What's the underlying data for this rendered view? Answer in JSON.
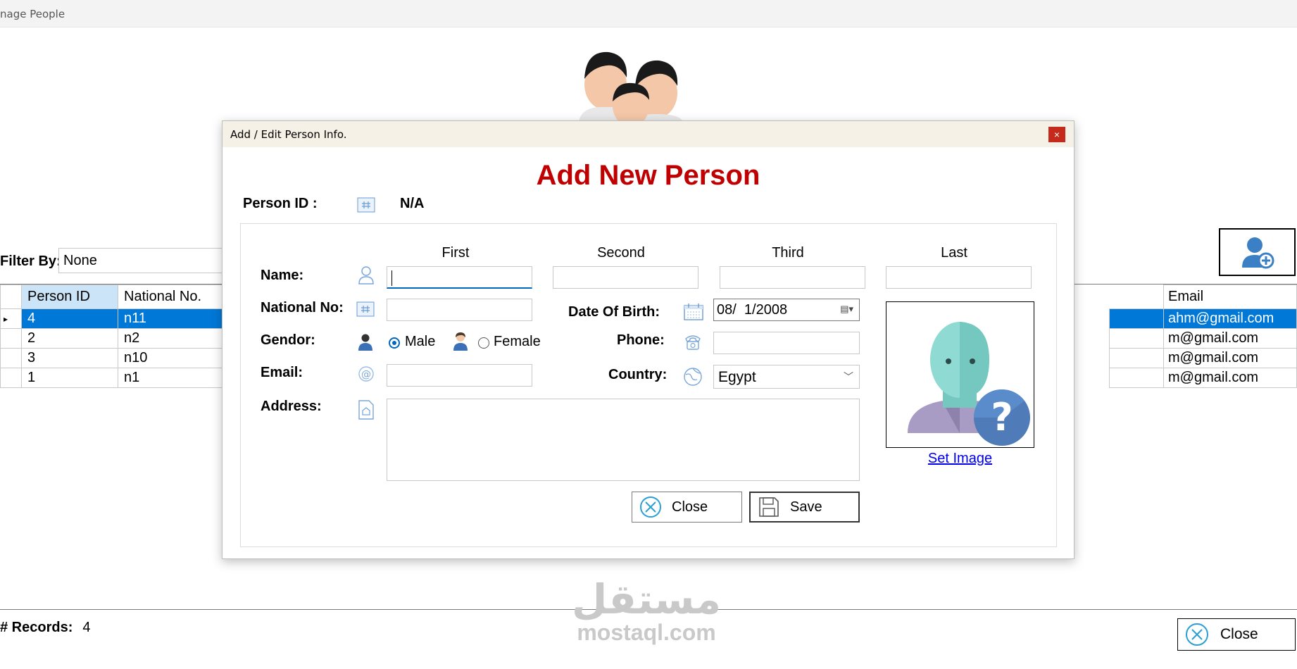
{
  "background_window": {
    "title": "nage People",
    "filter": {
      "label": "Filter By:",
      "value": "None"
    },
    "grid": {
      "columns_left": [
        "Person ID",
        "National No."
      ],
      "column_right": "Email",
      "rows": [
        {
          "marker": "▸",
          "person_id": "4",
          "national_no": "n11",
          "email": "ahm@gmail.com",
          "selected": true
        },
        {
          "marker": "",
          "person_id": "2",
          "national_no": "n2",
          "email": "m@gmail.com",
          "selected": false
        },
        {
          "marker": "",
          "person_id": "3",
          "national_no": "n10",
          "email": "m@gmail.com",
          "selected": false
        },
        {
          "marker": "",
          "person_id": "1",
          "national_no": "n1",
          "email": "m@gmail.com",
          "selected": false
        }
      ]
    },
    "records": {
      "label": "# Records:",
      "count": "4"
    },
    "close_label": "Close",
    "watermark": {
      "arabic": "مستقل",
      "latin": "mostaql.com"
    }
  },
  "dialog": {
    "title": "Add / Edit Person Info.",
    "close_glyph": "×",
    "heading": "Add New Person",
    "person_id": {
      "label": "Person ID :",
      "value": "N/A"
    },
    "name_columns": {
      "first": "First",
      "second": "Second",
      "third": "Third",
      "last": "Last"
    },
    "labels": {
      "name": "Name:",
      "national_no": "National No:",
      "gender": "Gendor:",
      "email": "Email:",
      "address": "Address:",
      "date_of_birth": "Date Of Birth:",
      "phone": "Phone:",
      "country": "Country:"
    },
    "fields": {
      "first_name": "",
      "second_name": "",
      "third_name": "",
      "last_name": "",
      "national_no": "",
      "email": "",
      "address": "",
      "phone": "",
      "date_of_birth": "08/  1/2008",
      "country": "Egypt"
    },
    "gender": {
      "male": "Male",
      "female": "Female",
      "selected": "male"
    },
    "set_image": "Set Image",
    "buttons": {
      "close": "Close",
      "save": "Save"
    }
  },
  "colors": {
    "heading": "#c00000",
    "selection": "#0078d7",
    "accent": "#0067c0",
    "close_red": "#c42b1c"
  },
  "icons": [
    "people-logo-icon",
    "add-person-icon",
    "close-circle-icon",
    "hash-icon",
    "person-outline-icon",
    "male-icon",
    "female-icon",
    "at-icon",
    "address-icon",
    "calendar-icon",
    "phone-icon",
    "globe-icon",
    "save-icon",
    "unknown-person-icon"
  ]
}
